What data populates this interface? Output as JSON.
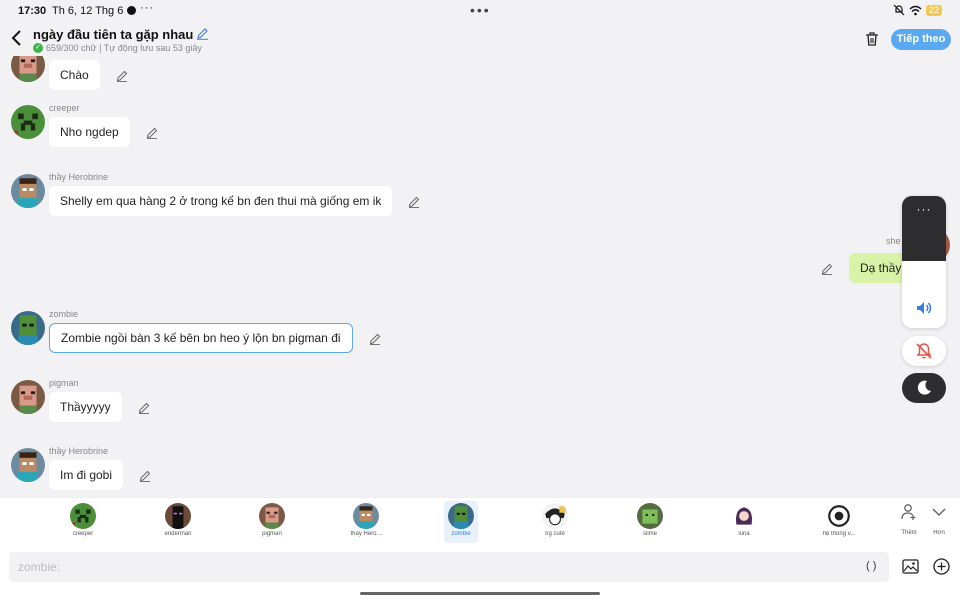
{
  "status_bar": {
    "time": "17:30",
    "date": "Th 6, 12 Thg 6",
    "more": "···",
    "center_dots": "•••",
    "battery": "22"
  },
  "header": {
    "title": "ngày đầu tiên ta gặp nhau",
    "subtitle": "659/300 chữ | Tự động lưu sau 53 giây",
    "next_label": "Tiếp theo"
  },
  "messages": [
    {
      "sender": "",
      "text": "Chào",
      "avatar": "pigman-avatar"
    },
    {
      "sender": "creeper",
      "text": "Nho ngdep",
      "avatar": "creeper-avatar"
    },
    {
      "sender": "thầy Herobrine",
      "text": "Shelly em qua hàng 2 ở trong kế bn đen thui mà giống em ik",
      "avatar": "herobrine-avatar"
    },
    {
      "sender": "she",
      "text": "Dạ thầy",
      "avatar": "shelly-avatar",
      "mine": true
    },
    {
      "sender": "zombie",
      "text": "Zombie ngồi bàn 3 kế bên bn heo ý lộn bn pigman đi",
      "avatar": "zombie-avatar",
      "selected": true
    },
    {
      "sender": "pigman",
      "text": "Thầyyyyy",
      "avatar": "pigman-avatar"
    },
    {
      "sender": "thầy Herobrine",
      "text": "Im đi gobi",
      "avatar": "herobrine-avatar"
    }
  ],
  "characters": [
    {
      "label": "creeper",
      "icon": "creeper-avatar"
    },
    {
      "label": "enderman",
      "icon": "enderman-avatar"
    },
    {
      "label": "pigman",
      "icon": "pigman-avatar"
    },
    {
      "label": "thầy Hero...",
      "icon": "herobrine-avatar"
    },
    {
      "label": "zombie",
      "icon": "zombie-avatar",
      "active": true
    },
    {
      "label": "t/g cute",
      "icon": "author-avatar"
    },
    {
      "label": "slime",
      "icon": "slime-avatar"
    },
    {
      "label": "luna",
      "icon": "luna-avatar"
    },
    {
      "label": "hệ thống v...",
      "icon": "system-avatar"
    }
  ],
  "tools": {
    "add_label": "Thêm",
    "more_label": "Hơn"
  },
  "input": {
    "placeholder": "zombie:",
    "paren": "( )"
  },
  "floating": {
    "dots": "···"
  },
  "colors": {
    "accent": "#5aa7f2",
    "mine_bubble": "#d8f2a8",
    "dark_panel": "#2d2d2f",
    "mute_red": "#e5534b"
  }
}
